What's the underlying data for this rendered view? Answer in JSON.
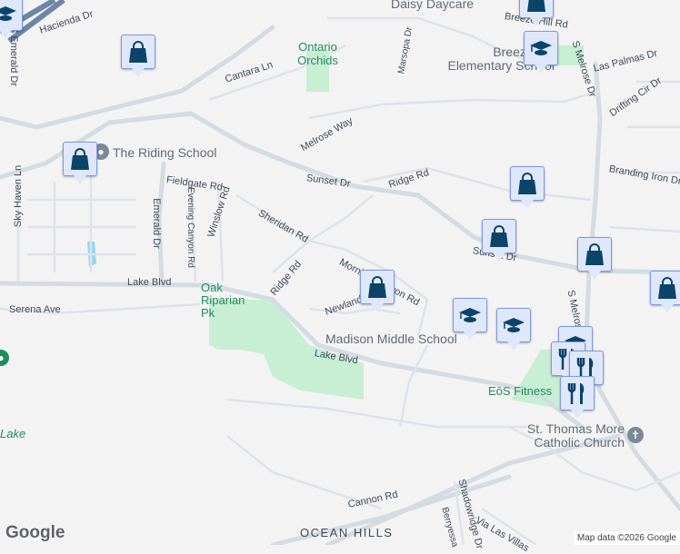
{
  "streets": [
    "Hacienda Dr",
    "S Emerald Dr",
    "Cantara Ln",
    "Melrose Way",
    "Sunset Dr",
    "Ridge Rd",
    "Fieldgate Rd",
    "Evening Canyon Rd",
    "Winslow Rd",
    "Sheridan Rd",
    "Emerald Dr",
    "Sky Haven Ln",
    "Lake Blvd",
    "Serena Ave",
    "Ridge Rd",
    "Morning Canyon Rd",
    "Newland Rd",
    "Lake Blvd",
    "Marsopa Dr",
    "Breeze Hill Rd",
    "Las Palmas Dr",
    "Drifting Cir Dr",
    "Branding Iron Dr",
    "Sunset Dr",
    "S Melrose Dr",
    "S Melrose Dr",
    "Cannon Rd",
    "Shadowridge Dr",
    "Berryessa",
    "Via Las Villas"
  ],
  "places": {
    "riding_school": "The Riding School",
    "daisy": "Daisy Daycare",
    "breeze": "Breeze Hill Elementary School",
    "madison": "Madison Middle School",
    "church": "St. Thomas More Catholic Church",
    "eos": "EōS Fitness",
    "orchids": "Ontario Orchids",
    "oak": "Oak Riparian Pk",
    "lake": "Lake"
  },
  "area": "OCEAN HILLS",
  "markers": {
    "shopping": "shopping-bag-icon",
    "school": "graduation-cap-icon",
    "restaurant": "fork-knife-icon"
  },
  "logo": "Google",
  "attribution": "Map data ©2026 Google",
  "colors": {
    "marker_fill": "#dfe8fb",
    "marker_icon": "#0b4468",
    "park": "#c4ecd0",
    "road": "#d4dce3"
  }
}
